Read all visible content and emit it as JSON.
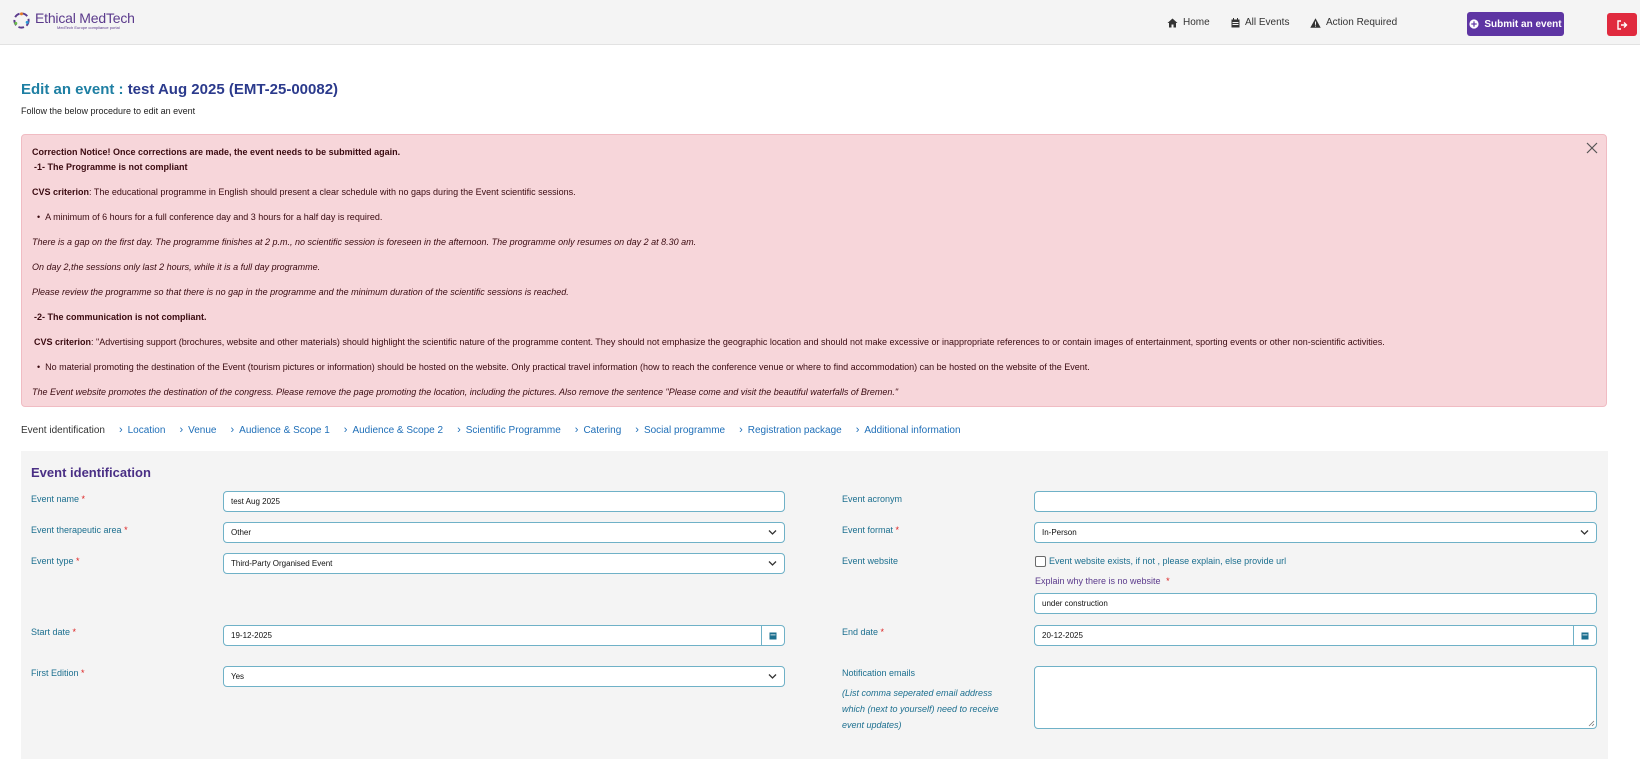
{
  "brand": {
    "name": "Ethical MedTech",
    "tagline": "MedTech Europe compliance portal",
    "logo_colors": [
      "#5b3a8c",
      "#e27a2d",
      "#2b9ad6",
      "#6cbf4b"
    ]
  },
  "nav": {
    "home": "Home",
    "all_events": "All Events",
    "action_required": "Action Required",
    "submit": "Submit an event"
  },
  "page": {
    "title_prefix": "Edit an event : ",
    "title_event": "test Aug 2025 (EMT-25-00082)",
    "subtitle": "Follow the below procedure to edit an event"
  },
  "alert": {
    "notice": "Correction Notice! Once corrections are made, the event needs to be submitted again.",
    "issue1_title": "-1- The Programme is not compliant",
    "cvs1_label": "CVS criterion",
    "cvs1_text": ": The educational programme in English should present a clear schedule with no gaps during the Event scientific sessions.",
    "bullet1": "A minimum of 6 hours for a full conference day and 3 hours for a half day is required.",
    "comment1a": "There is a gap on the first day. The programme finishes at 2 p.m., no scientific session is foreseen in the afternoon. The programme only resumes on day 2 at 8.30 am.",
    "comment1b": "On day 2,the sessions only last 2 hours, while it is a full day programme.",
    "comment1c": "Please review the programme so that there is no gap in the programme and the minimum duration of the scientific sessions is reached.",
    "issue2_title": "-2- The communication is not compliant.",
    "cvs2_label": "CVS criterion",
    "cvs2_text": ": \"Advertising support (brochures, website and other materials) should highlight the scientific nature of the programme content. They should not emphasize the geographic location and should not make excessive or inappropriate references to or contain images of entertainment, sporting events or other non-scientific activities.",
    "bullet2": "No material promoting the destination of the Event (tourism pictures or information) should be hosted on the website. Only practical travel information (how to reach the conference venue or where to find accommodation) can be hosted on the website of the Event.",
    "comment2": "The Event website promotes the destination of the congress. Please remove the page promoting the location, including the pictures. Also remove the sentence \"Please come and visit the beautiful waterfalls of Bremen.\""
  },
  "steps": [
    "Event identification",
    "Location",
    "Venue",
    "Audience & Scope 1",
    "Audience & Scope 2",
    "Scientific Programme",
    "Catering",
    "Social programme",
    "Registration package",
    "Additional information"
  ],
  "form": {
    "section_title": "Event identification",
    "required_mark": "*",
    "event_name": {
      "label": "Event name",
      "value": "test Aug 2025"
    },
    "therapeutic_area": {
      "label": "Event therapeutic area",
      "value": "Other"
    },
    "event_type": {
      "label": "Event type",
      "value": "Third-Party Organised Event"
    },
    "start_date": {
      "label": "Start date",
      "value": "19-12-2025"
    },
    "first_edition": {
      "label": "First Edition",
      "value": "Yes"
    },
    "acronym": {
      "label": "Event acronym",
      "value": ""
    },
    "format": {
      "label": "Event format",
      "value": "In-Person"
    },
    "website": {
      "label": "Event website",
      "checkbox_label": "Event website exists, if not , please explain, else provide url",
      "checked": false,
      "no_site_label": "Explain why there is no website",
      "no_site_value": "under construction"
    },
    "end_date": {
      "label": "End date",
      "value": "20-12-2025"
    },
    "notifications": {
      "label": "Notification emails",
      "hint1": "(List comma seperated email address",
      "hint2": "which (next to yourself) need to receive",
      "hint3": "event updates)",
      "value": ""
    }
  },
  "colors": {
    "primary": "#5e35a3",
    "danger": "#e02a3e",
    "alert_bg": "#f7d6da",
    "label": "#1c6f8f",
    "link": "#1f6fb8",
    "title": "#2b3a8c"
  }
}
